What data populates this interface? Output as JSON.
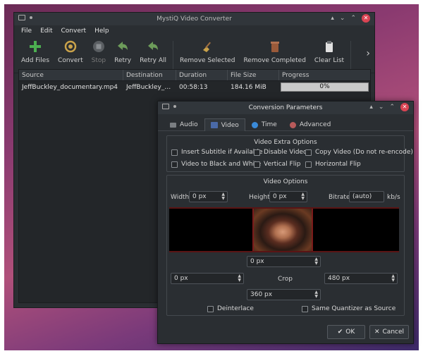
{
  "main_window": {
    "title": "MystiQ Video Converter",
    "menu": [
      "File",
      "Edit",
      "Convert",
      "Help"
    ],
    "toolbar": {
      "add_files": "Add Files",
      "convert": "Convert",
      "stop": "Stop",
      "retry": "Retry",
      "retry_all": "Retry All",
      "remove_selected": "Remove Selected",
      "remove_completed": "Remove Completed",
      "clear_list": "Clear List",
      "more": "›"
    },
    "columns": [
      "Source",
      "Destination",
      "Duration",
      "File Size",
      "Progress"
    ],
    "rows": [
      {
        "source": "JeffBuckley_documentary.mp4",
        "destination": "JeffBuckley_doc...",
        "duration": "00:58:13",
        "size": "184.16 MiB",
        "progress_text": "0%",
        "progress": 0
      }
    ]
  },
  "dialog": {
    "title": "Conversion Parameters",
    "tabs": [
      "Audio",
      "Video",
      "Time",
      "Advanced"
    ],
    "active_tab": "Video",
    "extra_options": {
      "title": "Video Extra Options",
      "insert_subtitle": "Insert Subtitle if Available",
      "disable_video": "Disable Video",
      "copy_video": "Copy Video (Do not re-encode)",
      "black_white": "Video to Black and White",
      "vertical_flip": "Vertical Flip",
      "horizontal_flip": "Horizontal Flip"
    },
    "video_options": {
      "title": "Video Options",
      "width_label": "Width",
      "width_value": "0 px",
      "height_label": "Height",
      "height_value": "0 px",
      "bitrate_label": "Bitrate",
      "bitrate_value": "(auto)",
      "bitrate_unit": "kb/s",
      "crop_label": "Crop",
      "crop_top": "0 px",
      "crop_left": "0 px",
      "crop_right": "480 px",
      "crop_bottom": "360 px",
      "deinterlace": "Deinterlace",
      "same_quantizer": "Same Quantizer as Source"
    },
    "ok": "OK",
    "cancel": "Cancel"
  },
  "colors": {
    "accent_green": "#4caf50",
    "close_red": "#da4453"
  }
}
